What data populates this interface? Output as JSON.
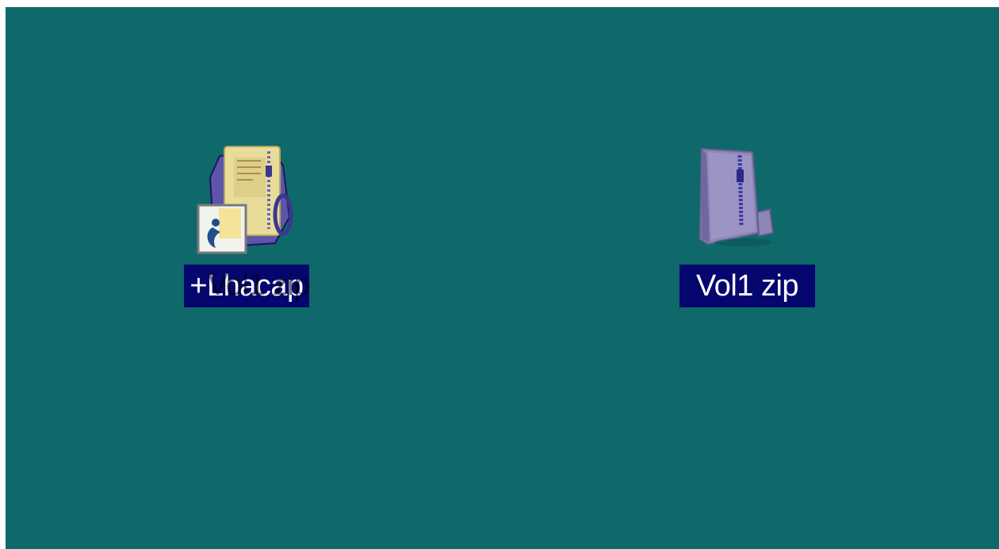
{
  "desktop": {
    "background_color": "#0f686a",
    "icons": [
      {
        "label": "+Lhacap",
        "drag_ghost_label": "Vol1 zip",
        "icon_name": "zip-folder-icon",
        "shortcut_overlay_icon": "shortcut-arrow-icon",
        "selected": true
      },
      {
        "label": "Vol1 zip",
        "icon_name": "zip-folder-icon",
        "selected": true
      }
    ],
    "selection_color": "#06066f"
  }
}
